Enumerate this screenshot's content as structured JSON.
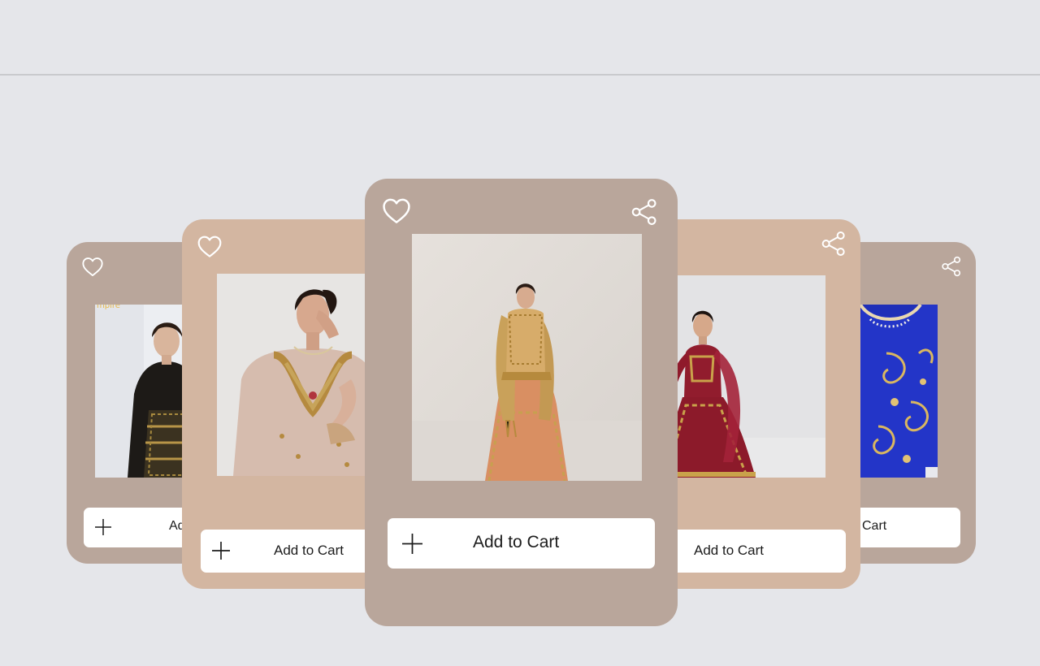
{
  "page": {
    "background": "#e5e6ea"
  },
  "icons": {
    "heart": "heart-icon",
    "share": "share-icon",
    "plus": "plus-icon"
  },
  "colors": {
    "card_dark": "#b9a69b",
    "card_light": "#d3b6a1",
    "button_bg": "#ffffff"
  },
  "cards": [
    {
      "id": "card-far-left",
      "photo": "model in black and gold embroidered outfit",
      "cart_label": "Add"
    },
    {
      "id": "card-left",
      "photo": "model in blush embellished outfit",
      "cart_label": "Add to Cart"
    },
    {
      "id": "card-center",
      "photo": "model in peach and gold lehenga",
      "cart_label": "Add to Cart"
    },
    {
      "id": "card-right",
      "photo": "model in maroon bridal lehenga",
      "cart_label": "Add to Cart"
    },
    {
      "id": "card-far-right",
      "photo": "royal blue outfit with gold paisley embroidery",
      "cart_label": "Cart"
    }
  ]
}
